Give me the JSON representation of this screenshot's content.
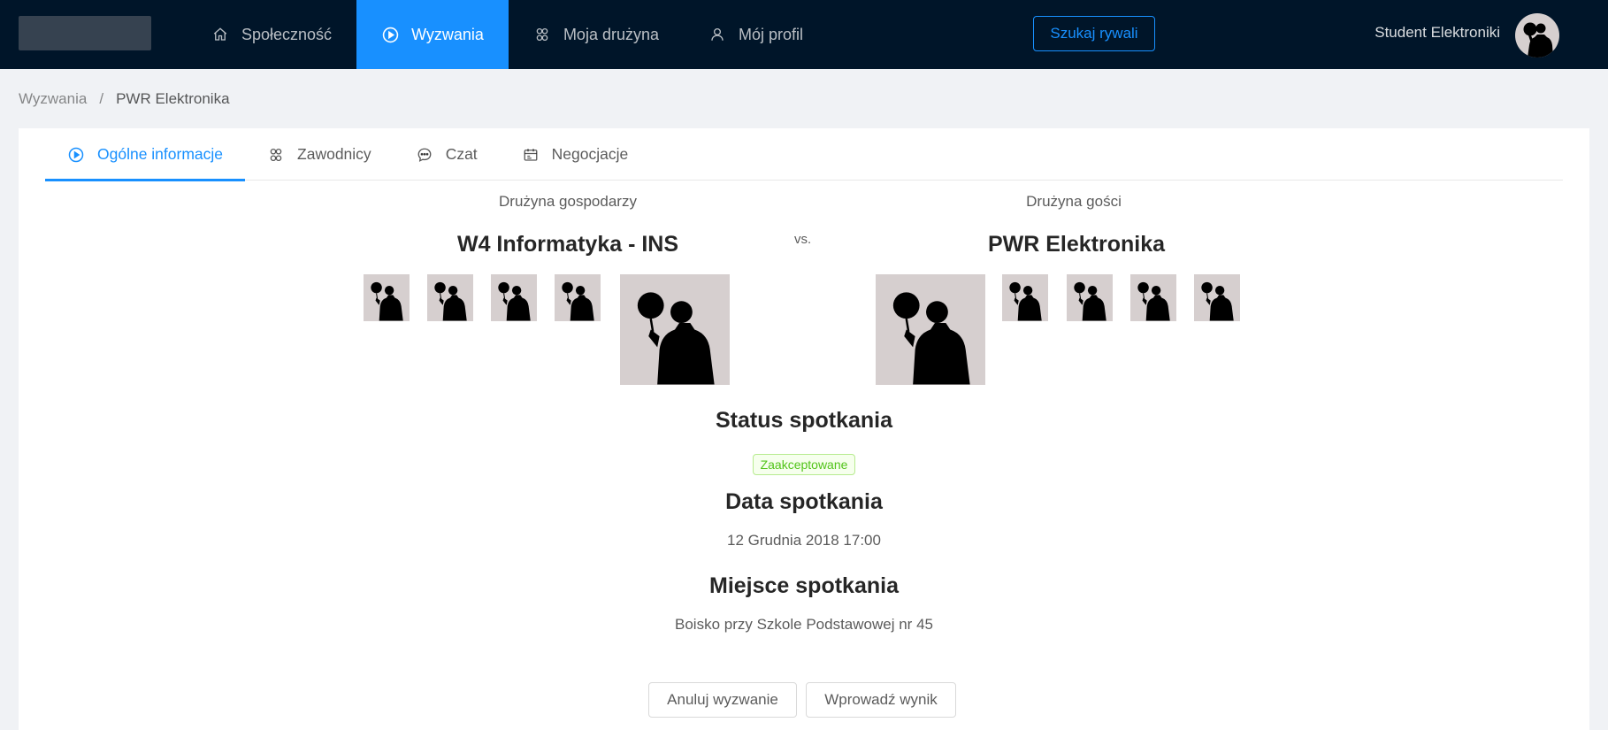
{
  "header": {
    "nav": [
      {
        "label": "Społeczność",
        "icon": "home-icon"
      },
      {
        "label": "Wyzwania",
        "icon": "play-circle-icon",
        "active": true
      },
      {
        "label": "Moja drużyna",
        "icon": "team-icon"
      },
      {
        "label": "Mój profil",
        "icon": "user-icon"
      }
    ],
    "search_button": "Szukaj rywali",
    "user_name": "Student Elektroniki"
  },
  "breadcrumb": {
    "parent": "Wyzwania",
    "separator": "/",
    "current": "PWR Elektronika"
  },
  "tabs": [
    {
      "label": "Ogólne informacje",
      "icon": "play-circle-icon",
      "active": true
    },
    {
      "label": "Zawodnicy",
      "icon": "team-icon"
    },
    {
      "label": "Czat",
      "icon": "message-icon"
    },
    {
      "label": "Negocjacje",
      "icon": "schedule-icon"
    }
  ],
  "match": {
    "home_caption": "Drużyna gospodarzy",
    "home_name": "W4 Informatyka - INS",
    "vs": "vs.",
    "away_caption": "Drużyna gości",
    "away_name": "PWR Elektronika",
    "status_title": "Status spotkania",
    "status_value": "Zaakceptowane",
    "date_title": "Data spotkania",
    "date_value": "12 Grudnia 2018 17:00",
    "place_title": "Miejsce spotkania",
    "place_value": "Boisko przy Szkole Podstawowej nr 45"
  },
  "actions": {
    "cancel": "Anuluj wyzwanie",
    "enter_result": "Wprowadź wynik"
  },
  "colors": {
    "header_bg": "#001529",
    "primary": "#1890ff",
    "success": "#52c41a"
  }
}
